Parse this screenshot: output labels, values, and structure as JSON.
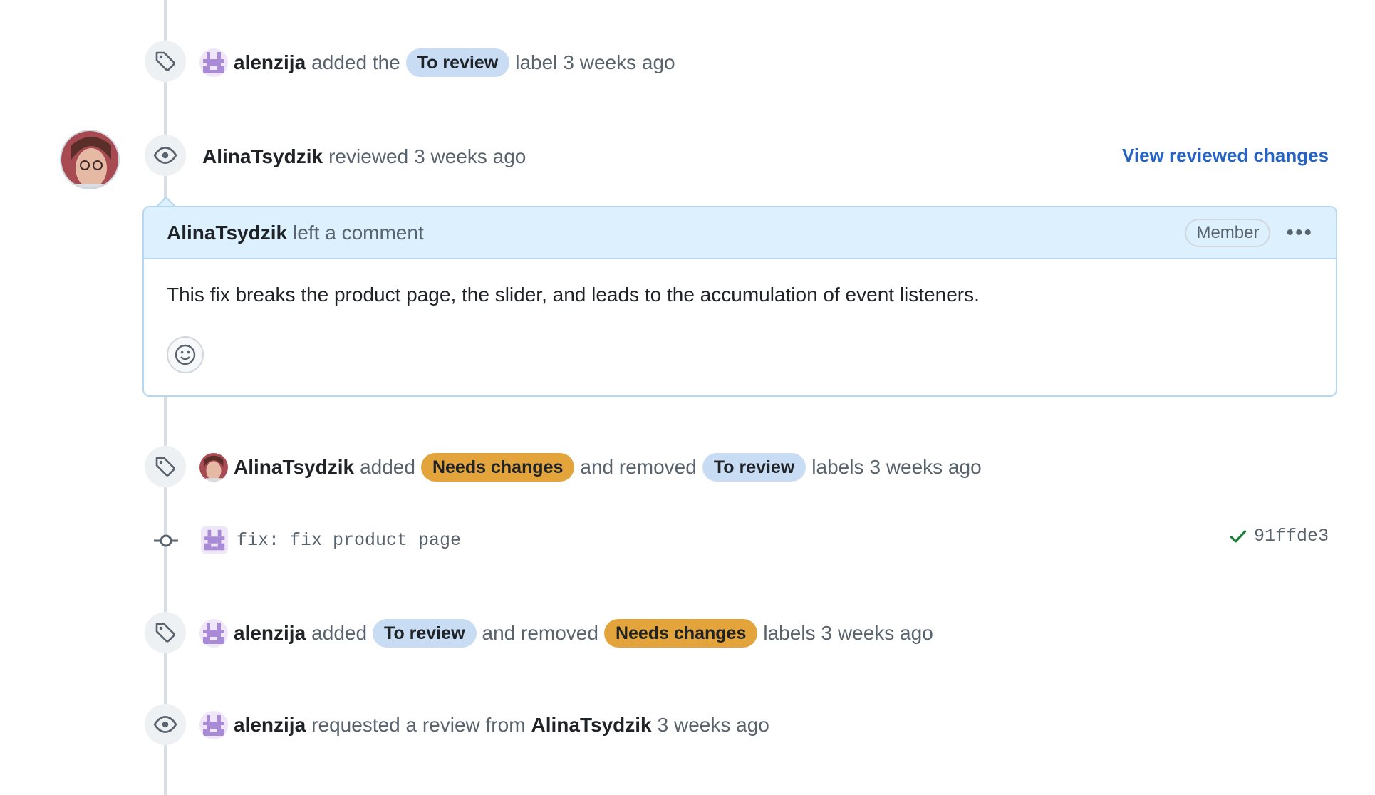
{
  "events": {
    "e1": {
      "actor": "alenzija",
      "text_a": "added the",
      "label": "To review",
      "text_b": "label",
      "time": "3 weeks ago"
    },
    "review": {
      "actor": "AlinaTsydzik",
      "action": "reviewed",
      "time": "3 weeks ago",
      "link": "View reviewed changes"
    },
    "comment": {
      "author": "AlinaTsydzik",
      "action": "left a comment",
      "role": "Member",
      "body": "This fix breaks the product page, the slider, and leads to the accumulation of event listeners."
    },
    "e3": {
      "actor": "AlinaTsydzik",
      "text_a": "added",
      "label_add": "Needs changes",
      "text_b": "and removed",
      "label_remove": "To review",
      "text_c": "labels",
      "time": "3 weeks ago"
    },
    "commit": {
      "message": "fix: fix product page",
      "sha": "91ffde3"
    },
    "e5": {
      "actor": "alenzija",
      "text_a": "added",
      "label_add": "To review",
      "text_b": "and removed",
      "label_remove": "Needs changes",
      "text_c": "labels",
      "time": "3 weeks ago"
    },
    "e6": {
      "actor": "alenzija",
      "text_a": "requested a review from",
      "target": "AlinaTsydzik",
      "time": "3 weeks ago"
    }
  },
  "colors": {
    "label_to_review": "#c8dcf3",
    "label_needs_changes": "#e3a43c",
    "link": "#2563c4"
  }
}
